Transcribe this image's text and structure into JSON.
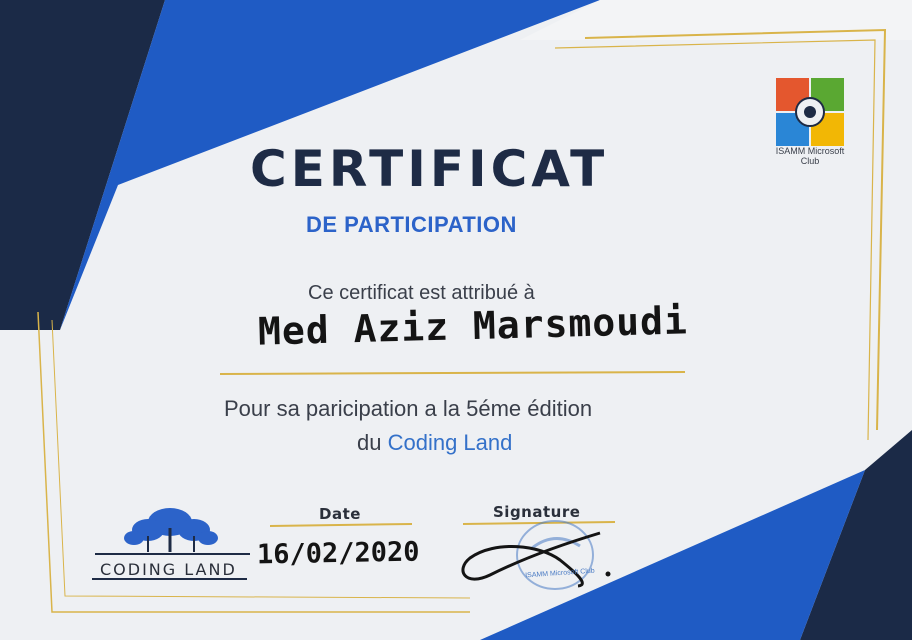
{
  "certificate": {
    "title": "CERTIFICAT",
    "subtitle": "DE PARTICIPATION",
    "intro": "Ce certificat est attribué à",
    "recipient": "Med Aziz Marsmoudi",
    "reason_line1": "Pour sa paricipation a la 5éme édition",
    "reason_line2_prefix": "du ",
    "event_name": "Coding Land",
    "date_label": "Date",
    "date_value": "16/02/2020",
    "signature_label": "Signature"
  },
  "club_logo": {
    "name": "ISAMM Microsoft Club",
    "icon": "windows-eye-icon"
  },
  "stamp": {
    "text": "ISAMM Microsoft Club"
  },
  "event_logo": {
    "text": "CODING LAND",
    "icon": "cloud-tree-icon"
  },
  "colors": {
    "navy": "#1e2b45",
    "blue": "#2c63c9",
    "gold": "#d9b44a",
    "paper": "#f4f5f7"
  }
}
